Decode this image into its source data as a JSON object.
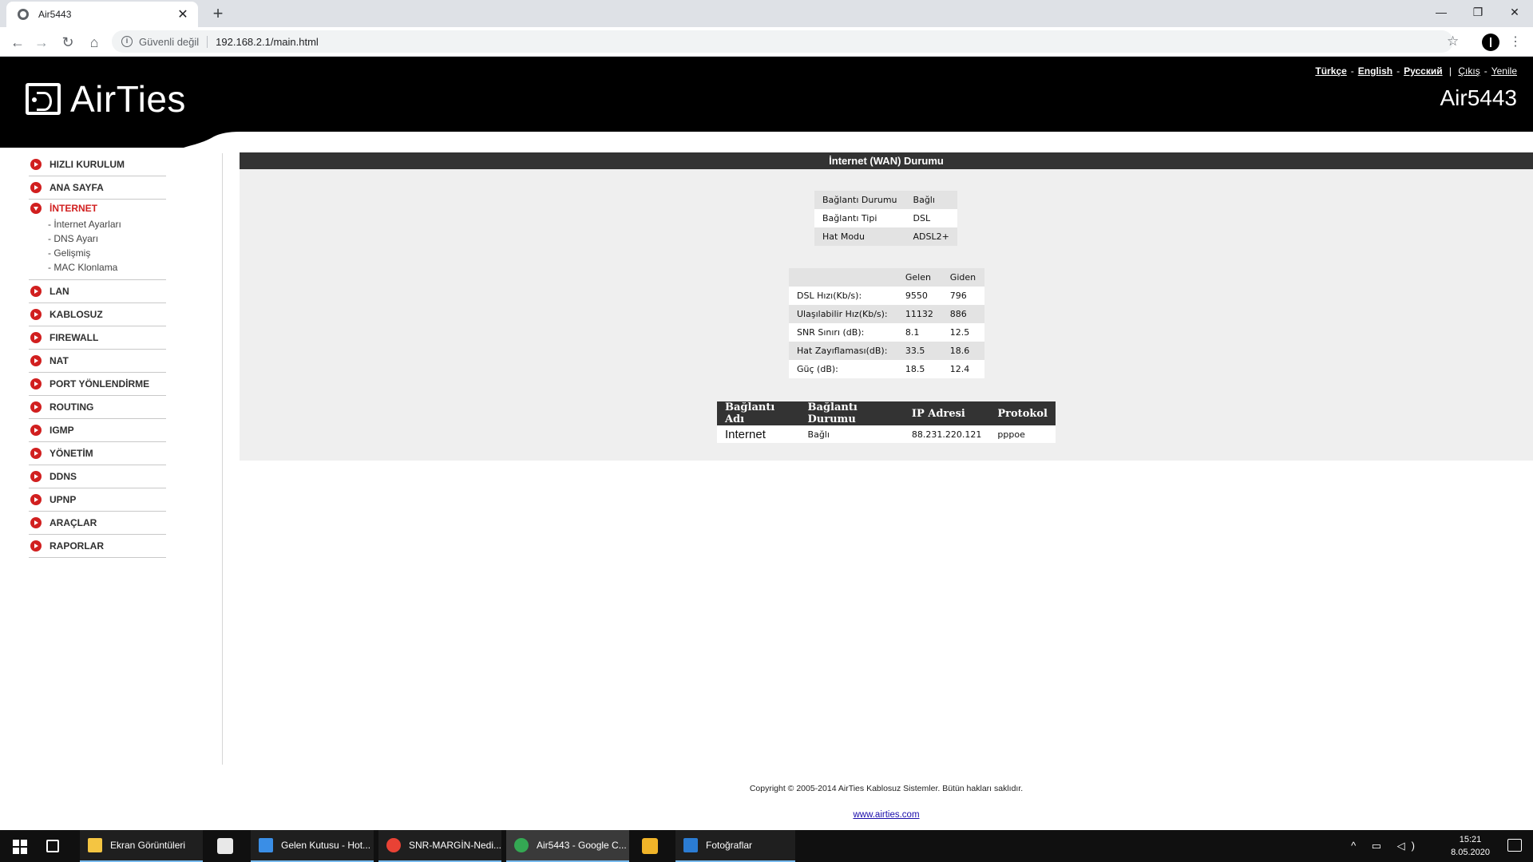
{
  "browser": {
    "tab_title": "Air5443",
    "tab_close": "✕",
    "new_tab": "+",
    "security_label": "Güvenli değil",
    "url": "192.168.2.1/main.html",
    "minimize": "—",
    "restore": "❐",
    "close": "✕"
  },
  "header": {
    "brand": "AirTies",
    "model": "Air5443",
    "langs": [
      "Türkçe",
      "English",
      "Русский"
    ],
    "logout": "Çıkış",
    "refresh": "Yenile"
  },
  "sidebar": {
    "items": [
      {
        "label": "HIZLI KURULUM"
      },
      {
        "label": "ANA SAYFA"
      },
      {
        "label": "İNTERNET"
      },
      {
        "label": "LAN"
      },
      {
        "label": "KABLOSUZ"
      },
      {
        "label": "FIREWALL"
      },
      {
        "label": "NAT"
      },
      {
        "label": "PORT YÖNLENDİRME"
      },
      {
        "label": "ROUTING"
      },
      {
        "label": "IGMP"
      },
      {
        "label": "YÖNETİM"
      },
      {
        "label": "DDNS"
      },
      {
        "label": "UPNP"
      },
      {
        "label": "ARAÇLAR"
      },
      {
        "label": "RAPORLAR"
      }
    ],
    "internet_sub": [
      "- İnternet Ayarları",
      "- DNS Ayarı",
      "- Gelişmiş",
      "- MAC Klonlama"
    ]
  },
  "content": {
    "title": "İnternet (WAN) Durumu",
    "status": [
      {
        "label": "Bağlantı Durumu",
        "value": "Bağlı"
      },
      {
        "label": "Bağlantı Tipi",
        "value": "DSL"
      },
      {
        "label": "Hat Modu",
        "value": "ADSL2+"
      }
    ],
    "dsl_headers": [
      "",
      "Gelen",
      "Giden"
    ],
    "dsl_rows": [
      {
        "label": "DSL Hızı(Kb/s):",
        "in": "9550",
        "out": "796"
      },
      {
        "label": "Ulaşılabilir Hız(Kb/s):",
        "in": "11132",
        "out": "886"
      },
      {
        "label": "SNR Sınırı (dB):",
        "in": "8.1",
        "out": "12.5"
      },
      {
        "label": "Hat Zayıflaması(dB):",
        "in": "33.5",
        "out": "18.6"
      },
      {
        "label": "Güç (dB):",
        "in": "18.5",
        "out": "12.4"
      }
    ],
    "conn_headers": [
      "Bağlantı Adı",
      "Bağlantı Durumu",
      "IP Adresi",
      "Protokol"
    ],
    "conn_row": {
      "name": "Internet",
      "status": "Bağlı",
      "ip": "88.231.220.121",
      "protocol": "pppoe"
    }
  },
  "footer": {
    "copyright": "Copyright © 2005-2014 AirTies Kablosuz Sistemler. Bütün hakları saklıdır.",
    "url": "www.airties.com"
  },
  "taskbar": {
    "apps": [
      "Ekran Görüntüleri",
      "Gelen Kutusu - Hot...",
      "SNR-MARGİN-Nedi...",
      "Air5443 - Google C...",
      "Fotoğraflar"
    ],
    "time": "15:21",
    "date": "8.05.2020"
  },
  "colors": {
    "accent_red": "#d11f1f",
    "header_black": "#000000",
    "content_bg": "#efefef"
  }
}
